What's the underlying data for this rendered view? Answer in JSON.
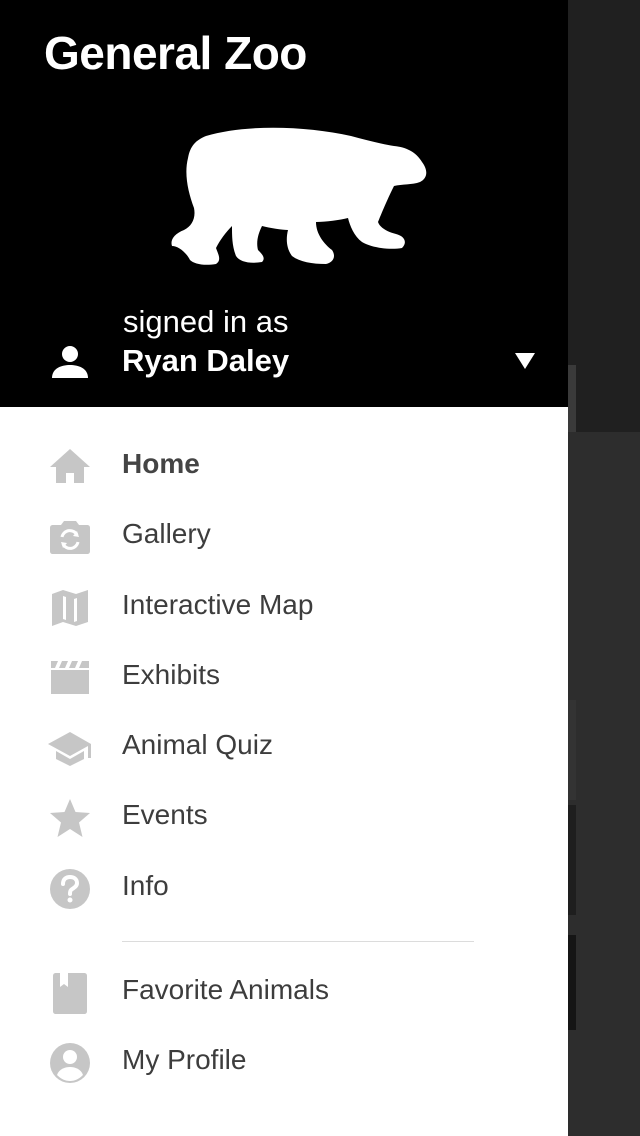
{
  "app": {
    "title": "General Zoo"
  },
  "account": {
    "signed_in_label": "signed in as",
    "user_name": "Ryan Daley"
  },
  "icons": {
    "logo": "polar-bear-logo",
    "user": "person-icon",
    "dropdown": "dropdown-arrow-icon"
  },
  "colors": {
    "header_bg": "#000000",
    "icon_gray": "#c6c6c6",
    "text_dark": "#3d3d3d"
  },
  "menu": {
    "primary": [
      {
        "label": "Home",
        "icon": "home-icon",
        "active": true
      },
      {
        "label": "Gallery",
        "icon": "camera-icon"
      },
      {
        "label": "Interactive Map",
        "icon": "map-icon"
      },
      {
        "label": "Exhibits",
        "icon": "clapperboard-icon"
      },
      {
        "label": "Animal Quiz",
        "icon": "graduation-cap-icon"
      },
      {
        "label": "Events",
        "icon": "star-icon"
      },
      {
        "label": "Info",
        "icon": "help-icon"
      }
    ],
    "secondary": [
      {
        "label": "Favorite Animals",
        "icon": "bookmark-icon"
      },
      {
        "label": "My Profile",
        "icon": "account-circle-icon"
      }
    ]
  }
}
